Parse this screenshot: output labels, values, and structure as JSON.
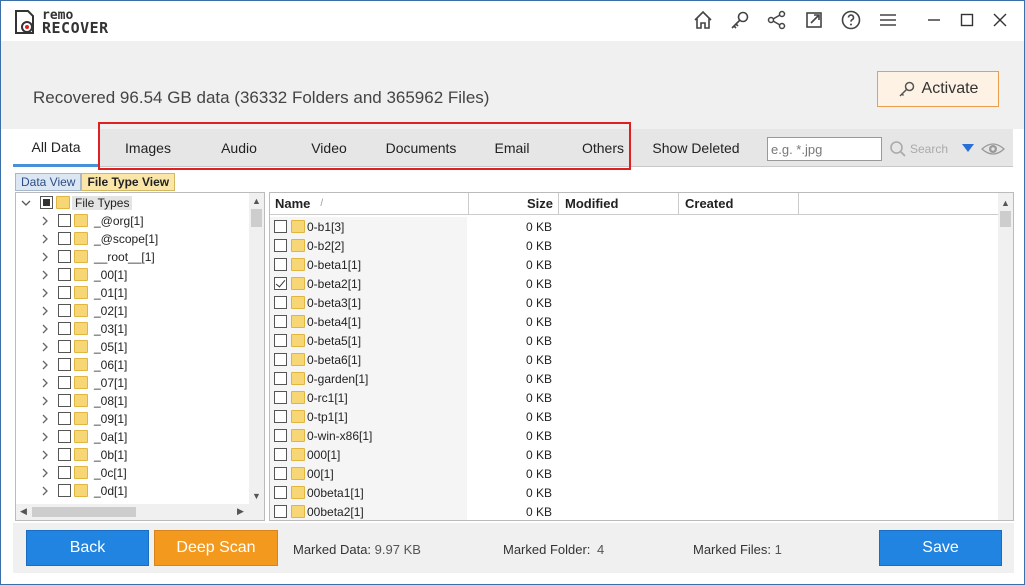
{
  "app": {
    "logo_line1": "remo",
    "logo_line2": "RECOVER"
  },
  "titlebar_icons": [
    "home-icon",
    "key-icon",
    "share-icon",
    "external-link-icon",
    "help-icon",
    "menu-icon",
    "minimize-icon",
    "maximize-icon",
    "close-icon"
  ],
  "header": {
    "recovered_text": "Recovered 96.54 GB data (36332 Folders and 365962 Files)",
    "activate_label": "Activate"
  },
  "tabs": [
    {
      "label": "All Data",
      "active": true
    },
    {
      "label": "Images"
    },
    {
      "label": "Audio"
    },
    {
      "label": "Video"
    },
    {
      "label": "Documents"
    },
    {
      "label": "Email"
    },
    {
      "label": "Others"
    },
    {
      "label": "Show Deleted"
    }
  ],
  "search": {
    "placeholder": "e.g. *.jpg",
    "button_label": "Search"
  },
  "view_tabs": {
    "data_view": "Data View",
    "file_type_view": "File Type View"
  },
  "tree": {
    "root_label": "File Types",
    "items": [
      "_@org[1]",
      "_@scope[1]",
      "__root__[1]",
      "_00[1]",
      "_01[1]",
      "_02[1]",
      "_03[1]",
      "_05[1]",
      "_06[1]",
      "_07[1]",
      "_08[1]",
      "_09[1]",
      "_0a[1]",
      "_0b[1]",
      "_0c[1]",
      "_0d[1]"
    ]
  },
  "list": {
    "columns": {
      "name": "Name",
      "size": "Size",
      "modified": "Modified",
      "created": "Created"
    },
    "rows": [
      {
        "name": "0-b1[3]",
        "size": "0 KB",
        "checked": false
      },
      {
        "name": "0-b2[2]",
        "size": "0 KB",
        "checked": false
      },
      {
        "name": "0-beta1[1]",
        "size": "0 KB",
        "checked": false
      },
      {
        "name": "0-beta2[1]",
        "size": "0 KB",
        "checked": true
      },
      {
        "name": "0-beta3[1]",
        "size": "0 KB",
        "checked": false
      },
      {
        "name": "0-beta4[1]",
        "size": "0 KB",
        "checked": false
      },
      {
        "name": "0-beta5[1]",
        "size": "0 KB",
        "checked": false
      },
      {
        "name": "0-beta6[1]",
        "size": "0 KB",
        "checked": false
      },
      {
        "name": "0-garden[1]",
        "size": "0 KB",
        "checked": false
      },
      {
        "name": "0-rc1[1]",
        "size": "0 KB",
        "checked": false
      },
      {
        "name": "0-tp1[1]",
        "size": "0 KB",
        "checked": false
      },
      {
        "name": "0-win-x86[1]",
        "size": "0 KB",
        "checked": false
      },
      {
        "name": "000[1]",
        "size": "0 KB",
        "checked": false
      },
      {
        "name": "00[1]",
        "size": "0 KB",
        "checked": false
      },
      {
        "name": "00beta1[1]",
        "size": "0 KB",
        "checked": false
      },
      {
        "name": "00beta2[1]",
        "size": "0 KB",
        "checked": false
      }
    ]
  },
  "bottom": {
    "back_label": "Back",
    "deep_scan_label": "Deep Scan",
    "marked_data_label": "Marked Data:",
    "marked_data_value": "9.97 KB",
    "marked_folder_label": "Marked Folder:",
    "marked_folder_value": "4",
    "marked_files_label": "Marked Files:",
    "marked_files_value": "1",
    "save_label": "Save"
  },
  "colors": {
    "accent_blue": "#2184e0",
    "accent_orange": "#f39a1e",
    "highlight_red": "#e02020"
  }
}
